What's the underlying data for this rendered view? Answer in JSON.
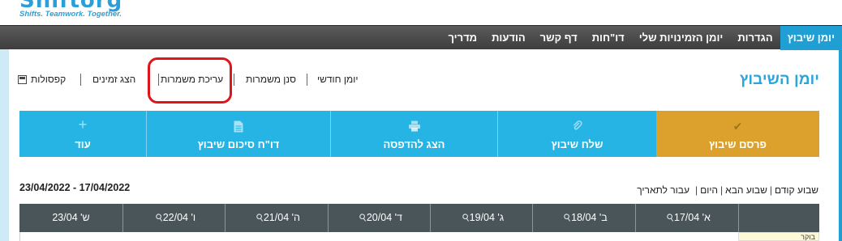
{
  "logo": {
    "name": "Shiftorg",
    "tagline": "Shifts. Teamwork. Together."
  },
  "nav": {
    "items": [
      {
        "label": "יומן שיבוץ",
        "active": true
      },
      {
        "label": "הגדרות"
      },
      {
        "label": "יומן הזמינויות שלי"
      },
      {
        "label": "דו\"חות"
      },
      {
        "label": "דף קשר"
      },
      {
        "label": "הודעות"
      },
      {
        "label": "מדריך"
      }
    ]
  },
  "page_title": "יומן השיבוץ",
  "views": {
    "monthly": "יומן חודשי",
    "shift_filter": "סנן משמרות",
    "edit_shifts": "עריכת משמרות",
    "show_availability": "הצג זמינים",
    "capsules": "קפסולות",
    "capsules_icon": "calendar-icon"
  },
  "actions": [
    {
      "label": "פרסם שיבוץ",
      "icon": "check-icon",
      "color": "#dca12c"
    },
    {
      "label": "שלח שיבוץ",
      "icon": "paperclip-icon",
      "color": "#25b4e3"
    },
    {
      "label": "הצג להדפסה",
      "icon": "print-icon",
      "color": "#25b4e3"
    },
    {
      "label": "דו\"ח סיכום שיבוץ",
      "icon": "document-icon",
      "color": "#25b4e3"
    },
    {
      "label": "עוד",
      "icon": "plus-icon",
      "color": "#25b4e3"
    }
  ],
  "date_range": "23/04/2022 - 17/04/2022",
  "week_nav": {
    "prev": "שבוע קודם",
    "next": "שבוע הבא",
    "today": "היום",
    "goto": "עבור לתאריך"
  },
  "days": [
    {
      "label": "א' 17/04"
    },
    {
      "label": "ב' 18/04"
    },
    {
      "label": "ג' 19/04"
    },
    {
      "label": "ד' 20/04"
    },
    {
      "label": "ה' 21/04"
    },
    {
      "label": "ו' 22/04"
    },
    {
      "label": "ש' 23/04"
    }
  ],
  "first_row_label": "בוקר",
  "colors": {
    "accent": "#25b4e3",
    "publish": "#dca12c",
    "nav": "#4a4a4a",
    "grid_header": "#4a5559",
    "highlight": "#e0141b"
  }
}
